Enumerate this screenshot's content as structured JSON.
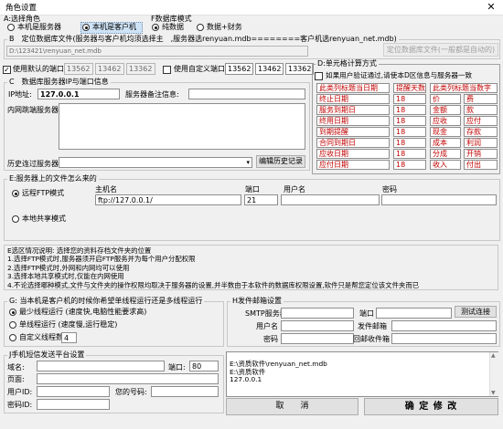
{
  "window": {
    "title": "角色设置",
    "close": "✕"
  },
  "sectionA": {
    "caption": "A:选择角色",
    "opt_server": "本机是服务器",
    "opt_client": "本机是客户机",
    "selected": "client"
  },
  "sectionF": {
    "caption": "F数据库模式",
    "opt_pure": "纯数据",
    "opt_finance": "数据+财务",
    "selected": "pure"
  },
  "sectionB": {
    "caption": "B　定位数据库文件(服务器与客户机均须选择主　,服务器选renyuan.mdb========客户机选renyuan_net.mdb)",
    "path": "D:\\123421\\renyuan_net.mdb",
    "locate_button": "定位数据库文件(一般都是自动的)"
  },
  "ports": {
    "default_label": "使用默认的端口",
    "default_checked": true,
    "default_values": [
      "13562",
      "13462",
      "13362"
    ],
    "custom_label": "使用自定义端口",
    "custom_checked": false,
    "custom_values": [
      "13562",
      "13462",
      "13362"
    ]
  },
  "sectionC": {
    "caption": "C　数据库服务器IP与端口信息",
    "ip_label": "IP地址:",
    "ip_value": "127.0.0.1",
    "note_label": "服务器备注信息:",
    "note_value": "",
    "list_label": "内网跳端服务器",
    "history_label": "历史连过服务器",
    "history_value": "",
    "history_button": "编辑历史记录"
  },
  "sectionD": {
    "caption": "D:单元格计算方式",
    "verify_label": "如果用户验证通过,请使本D区信息与服务器一致",
    "verify_checked": false,
    "col1_header": "此类列标题当日期",
    "col2_header": "提醒天数",
    "col3_header": "此类列标题当数字",
    "dates": [
      "终止日期",
      "服务到期日",
      "终用日期",
      "到期提醒",
      "合同到期日",
      "应收日期",
      "应付日期"
    ],
    "days": [
      "18",
      "18",
      "18",
      "18",
      "18",
      "18",
      "18"
    ],
    "numbers_a": [
      "价",
      "金额",
      "应收",
      "现金",
      "成本",
      "分成",
      "收入"
    ],
    "numbers_b": [
      "费",
      "款",
      "应付",
      "存款",
      "利润",
      "开销",
      "付出"
    ]
  },
  "sectionE": {
    "caption": "E:服务器上的文件怎么来的",
    "opt_ftp": "远程FTP模式",
    "opt_share": "本地共享模式",
    "selected": "ftp",
    "col_host": "主机名",
    "col_port": "端口",
    "col_user": "用户名",
    "col_pass": "密码",
    "host_value": "ftp://127.0.0.1/",
    "port_value": "21",
    "user_value": "",
    "pass_value": ""
  },
  "explain": {
    "lines": [
      "E选区情况说明: 选择您的资料存档文件夹的位置",
      "1.选择FTP模式时,服务器须开启FTP服务并为每个用户分配权限",
      "2.选择FTP模式时,外网和内网均可以使用",
      "3.选择本地共享模式时,仅能在内网使用",
      "4.不论选择哪种模式,文件与文件夹的操作权限均取决于服务器的设置,并半数由于本软件的数据库权限设置,软件只是帮您定位该文件夹而已"
    ]
  },
  "sectionG": {
    "caption": "G: 当本机是客户机的时候你希望单线程运行还是多线程运行",
    "opt_multi": "最少线程运行 (速度快,电脑性能要求高)",
    "opt_single": "单线程运行 (速度慢,运行稳定)",
    "opt_custom": "自定义线程数",
    "custom_value": "4",
    "selected": "multi"
  },
  "sectionH": {
    "caption": "H发件邮箱设置",
    "smtp_label": "SMTP服务器",
    "port_label": "端口",
    "test_button": "测试连接",
    "user_label": "用户名",
    "sender_label": "发件邮箱",
    "pass_label": "密码",
    "reply_label": "回邮收件箱",
    "smtp_value": "",
    "port_value": "",
    "user_value": "",
    "sender_value": "",
    "pass_value": "",
    "reply_value": ""
  },
  "sectionJ": {
    "caption": "J手机短信发送平台设置",
    "domain_label": "域名:",
    "port_label": "端口:",
    "port_value": "80",
    "page_label": "页面:",
    "userid_label": "用户ID:",
    "phone_label": "您的号码:",
    "password_label": "密码ID:",
    "domain_value": "",
    "page_value": "",
    "userid_value": "",
    "phone_value": "",
    "password_value": ""
  },
  "log": {
    "lines": [
      "E:\\资质软件\\renyuan_net.mdb",
      "E:\\资质软件",
      "127.0.0.1"
    ]
  },
  "buttons": {
    "cancel": "取　　消",
    "confirm": "确 定 修 改"
  }
}
